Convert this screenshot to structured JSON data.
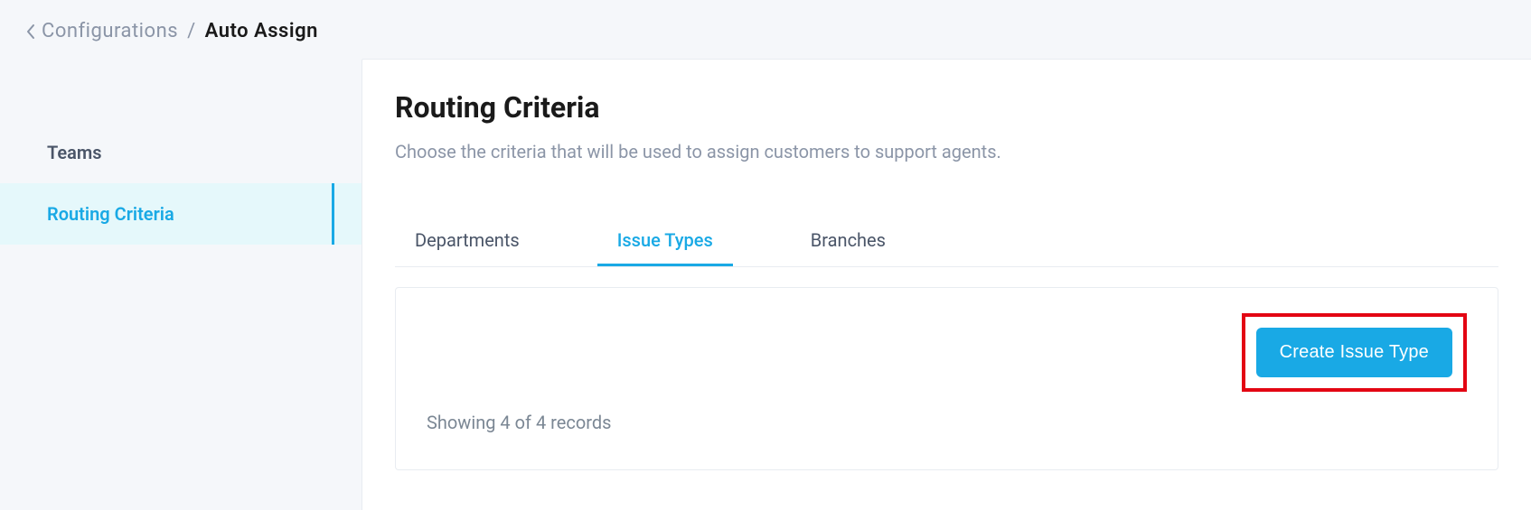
{
  "breadcrumb": {
    "parent": "Configurations",
    "current": "Auto Assign"
  },
  "sidebar": {
    "items": [
      {
        "label": "Teams",
        "active": false
      },
      {
        "label": "Routing Criteria",
        "active": true
      }
    ]
  },
  "main": {
    "title": "Routing Criteria",
    "subtitle": "Choose the criteria that will be used to assign customers to support agents.",
    "tabs": [
      {
        "label": "Departments",
        "active": false
      },
      {
        "label": "Issue Types",
        "active": true
      },
      {
        "label": "Branches",
        "active": false
      }
    ],
    "create_button": "Create Issue Type",
    "records_text": "Showing 4 of 4 records"
  }
}
